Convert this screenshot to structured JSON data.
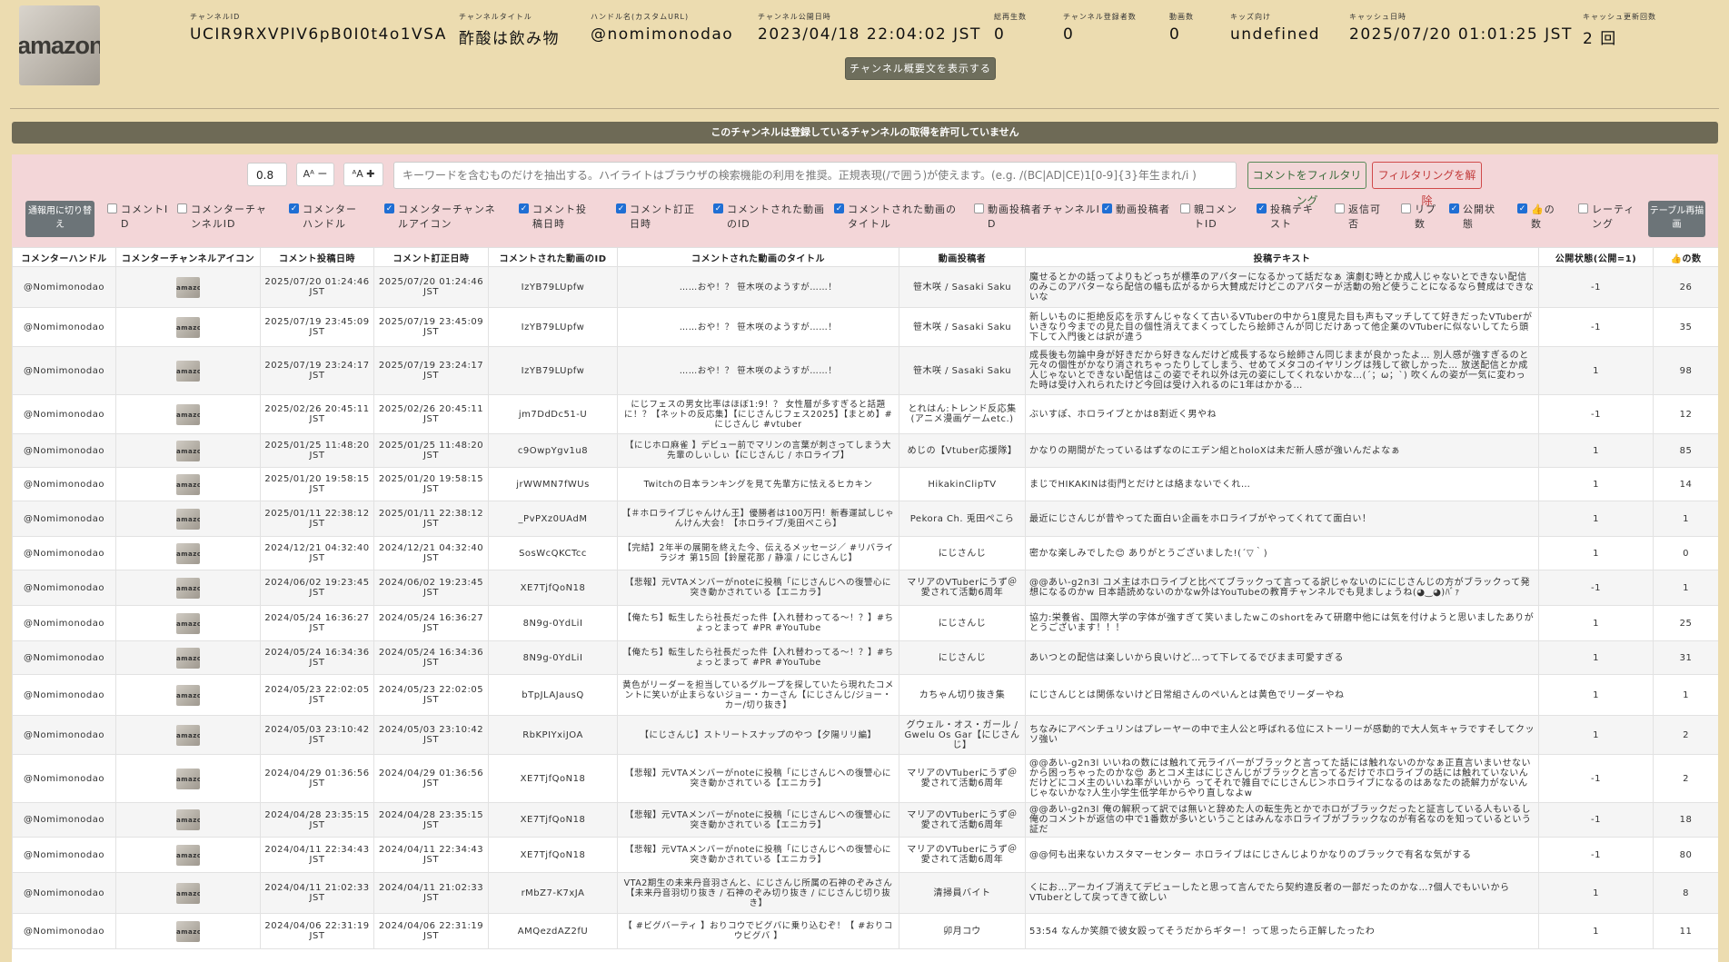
{
  "channel": {
    "stats": [
      {
        "label": "チャンネルID",
        "value": "UCIR9RXVPIV6pB0I0t4o1VSA"
      },
      {
        "label": "チャンネルタイトル",
        "value": "酢酸は飲み物"
      },
      {
        "label": "ハンドル名(カスタムURL)",
        "value": "@nomimonodao"
      },
      {
        "label": "チャンネル公開日時",
        "value": "2023/04/18 22:04:02 JST"
      },
      {
        "label": "総再生数",
        "value": "0"
      },
      {
        "label": "チャンネル登録者数",
        "value": "0"
      },
      {
        "label": "動画数",
        "value": "0"
      },
      {
        "label": "キッズ向け",
        "value": "undefined"
      },
      {
        "label": "キャッシュ日時",
        "value": "2025/07/20 01:01:25 JST"
      },
      {
        "label": "キャッシュ更新回数",
        "value": "2 回"
      }
    ],
    "avatar_text": "amazon",
    "desc_button": "チャンネル概要文を表示する",
    "notice": "このチャンネルは登録しているチャンネルの取得を許可していません"
  },
  "toolbar": {
    "zoom_value": "0.8",
    "font_minus": "Aᴬ ー",
    "font_plus": "ᴬA ✚",
    "search_placeholder": "キーワードを含むものだけを抽出する。ハイライトはブラウザの検索機能の利用を推奨。正規表現(/で囲う)が使えます。(e.g. /(BC|AD|CE)1[0-9]{3}年生まれ/i )",
    "filter_label": "コメントをフィルタリング",
    "clear_label": "フィルタリングを解除",
    "mode_label": "通報用に切り替え",
    "redraw_label": "テーブル再描画"
  },
  "column_toggles": [
    {
      "label": "コメントID",
      "checked": false
    },
    {
      "label": "コメンターチャンネルID",
      "checked": false
    },
    {
      "label": "コメンターハンドル",
      "checked": true
    },
    {
      "label": "コメンターチャンネルアイコン",
      "checked": true
    },
    {
      "label": "コメント投稿日時",
      "checked": true
    },
    {
      "label": "コメント訂正日時",
      "checked": true
    },
    {
      "label": "コメントされた動画のID",
      "checked": true
    },
    {
      "label": "コメントされた動画のタイトル",
      "checked": true
    },
    {
      "label": "動画投稿者チャンネルID",
      "checked": false
    },
    {
      "label": "動画投稿者",
      "checked": true
    },
    {
      "label": "親コメントID",
      "checked": false
    },
    {
      "label": "投稿テキスト",
      "checked": true
    },
    {
      "label": "返信可否",
      "checked": false
    },
    {
      "label": "リプ数",
      "checked": false
    },
    {
      "label": "公開状態",
      "checked": true
    },
    {
      "label": "👍の数",
      "checked": true
    },
    {
      "label": "レーティング",
      "checked": false
    }
  ],
  "table": {
    "headers": [
      "コメンターハンドル",
      "コメンターチャンネルアイコン",
      "コメント投稿日時",
      "コメント訂正日時",
      "コメントされた動画のID",
      "コメントされた動画のタイトル",
      "動画投稿者",
      "投稿テキスト",
      "公開状態(公開=1)",
      "👍の数"
    ],
    "rows": [
      {
        "handle": "@Nomimonodao",
        "posted": "2025/07/20 01:24:46 JST",
        "edited": "2025/07/20 01:24:46 JST",
        "video_id": "IzYB79LUpfw",
        "title": "……おや！？ 笹木咲のようすが……！",
        "author": "笹木咲 / Sasaki Saku",
        "text": "魔せるとかの話ってよりもどっちが標準のアバターになるかって話だなぁ 演劇む時とか成人じゃないとできない配信のみこのアバターなら配信の幅も広がるから大賛成だけどこのアバターが活動の殆ど使うことになるなら賛成はできないな",
        "status": "-1",
        "likes": "26"
      },
      {
        "handle": "@Nomimonodao",
        "posted": "2025/07/19 23:45:09 JST",
        "edited": "2025/07/19 23:45:09 JST",
        "video_id": "IzYB79LUpfw",
        "title": "……おや！？ 笹木咲のようすが……！",
        "author": "笹木咲 / Sasaki Saku",
        "text": "新しいものに拒絶反応を示すんじゃなくて古いるVTuberの中から1度見た目も声もマッチしてて好きだったVTuberがいきなり今までの見た目の個性消えてまくってしたら絵師さんが同じだけあって他企業のVTuberに似ないしてたら頭下して入門後とは訳が違う",
        "status": "-1",
        "likes": "35"
      },
      {
        "handle": "@Nomimonodao",
        "posted": "2025/07/19 23:24:17 JST",
        "edited": "2025/07/19 23:24:17 JST",
        "video_id": "IzYB79LUpfw",
        "title": "……おや！？ 笹木咲のようすが……！",
        "author": "笹木咲 / Sasaki Saku",
        "text": "成長後も勿論中身が好きだから好きなんだけど成長するなら絵師さん同じままが良かったよ… 別人感が強すぎるのと元々の個性がかなり消されちゃったりしてしまう、せめてメタコのイヤリングは残して欲しかった… 放送配信とか成人じゃないとできない配信はこの姿でそれ以外は元の姿にしてくれないかな…(´；ω；`) 吹くんの姿が一気に変わった時は受け入れられたけど今回は受け入れるのに1年はかかる…",
        "status": "1",
        "likes": "98"
      },
      {
        "handle": "@Nomimonodao",
        "posted": "2025/02/26 20:45:11 JST",
        "edited": "2025/02/26 20:45:11 JST",
        "video_id": "jm7DdDc51-U",
        "title": "にじフェスの男女比率はほぼ1:9！？ 女性層が多すぎると話題に！？【ネットの反応集】【にじさんじフェス2025】【まとめ】#にじさんじ #vtuber",
        "author": "とれはん:トレンド反応集(アニメ漫画ゲームetc.)",
        "text": "ぶいすぽ、ホロライブとかは8割近く男やね",
        "status": "-1",
        "likes": "12"
      },
      {
        "handle": "@Nomimonodao",
        "posted": "2025/01/25 11:48:20 JST",
        "edited": "2025/01/25 11:48:20 JST",
        "video_id": "c9OwpYgv1u8",
        "title": "【にじホロ麻雀 】デビュー前でマリンの言葉が刺さってしまう大先輩のしぃしぃ【にじさんじ / ホロライブ】",
        "author": "めじの【Vtuber応援隊】",
        "text": "かなりの期間がたっているはずなのにエデン組とholoXは未だ新人感が強いんだよなぁ",
        "status": "1",
        "likes": "85"
      },
      {
        "handle": "@Nomimonodao",
        "posted": "2025/01/20 19:58:15 JST",
        "edited": "2025/01/20 19:58:15 JST",
        "video_id": "jrWWMN7fWUs",
        "title": "Twitchの日本ランキングを見て先輩方に怯えるヒカキン",
        "author": "HikakinClipTV",
        "text": "まじでHIKAKINは街門とだけとは絡まないでくれ…",
        "status": "1",
        "likes": "14"
      },
      {
        "handle": "@Nomimonodao",
        "posted": "2025/01/11 22:38:12 JST",
        "edited": "2025/01/11 22:38:12 JST",
        "video_id": "_PvPXz0UAdM",
        "title": "【＃ホロライブじゃんけん王】優勝者は100万円！新春運試しじゃんけん大会！【ホロライブ/兎田ぺこら】",
        "author": "Pekora Ch. 兎田ぺこら",
        "text": "最近にじさんじが昔やってた面白い企画をホロライブがやってくれてて面白い！",
        "status": "1",
        "likes": "1"
      },
      {
        "handle": "@Nomimonodao",
        "posted": "2024/12/21 04:32:40 JST",
        "edited": "2024/12/21 04:32:40 JST",
        "video_id": "SosWcQKCTcc",
        "title": "【完結】2年半の展開を終えた今、伝えるメッセージ／ #リバライラジオ 第15回【鈴屋花那 / 静凛 / にじさんじ】",
        "author": "にじさんじ",
        "text": "密かな楽しみでした😊 ありがとうございました!(´▽｀)",
        "status": "1",
        "likes": "0"
      },
      {
        "handle": "@Nomimonodao",
        "posted": "2024/06/02 19:23:45 JST",
        "edited": "2024/06/02 19:23:45 JST",
        "video_id": "XE7TjfQoN18",
        "title": "【悲報】元VTAメンバーがnoteに投稿「にじさんじへの復讐心に突き動かされている【エニカラ】",
        "author": "マリアのVTuberにうず＠愛されて活動6周年",
        "text": "@@あい-g2n3l コメ主はホロライブと比べてブラックって言ってる訳じゃないのににじさんじの方がブラックって発想になるのかw 日本語読めないのかなw外はYouTubeの教育チャンネルでも見ましょうね(◕‿◕)ﾊﾞｧ",
        "status": "-1",
        "likes": "1"
      },
      {
        "handle": "@Nomimonodao",
        "posted": "2024/05/24 16:36:27 JST",
        "edited": "2024/05/24 16:36:27 JST",
        "video_id": "8N9g-0YdLiI",
        "title": "【俺たち】転生したら社長だった件【入れ替わってる〜！？】#ちょっとまって #PR #YouTube",
        "author": "にじさんじ",
        "text": "協力:栄養省、国際大学の字体が強すぎて笑いましたwこのshortをみて研磨中他には気を付けようと思いましたありがとうございます！！！",
        "status": "1",
        "likes": "25"
      },
      {
        "handle": "@Nomimonodao",
        "posted": "2024/05/24 16:34:36 JST",
        "edited": "2024/05/24 16:34:36 JST",
        "video_id": "8N9g-0YdLiI",
        "title": "【俺たち】転生したら社長だった件【入れ替わってる〜！？】#ちょっとまって #PR #YouTube",
        "author": "にじさんじ",
        "text": "あいつとの配信は楽しいから良いけど…って下レてるでびまま可愛すぎる",
        "status": "1",
        "likes": "31"
      },
      {
        "handle": "@Nomimonodao",
        "posted": "2024/05/23 22:02:05 JST",
        "edited": "2024/05/23 22:02:05 JST",
        "video_id": "bTpJLAJausQ",
        "title": "黄色がリーダーを担当しているグループを探していたら現れたコメントに笑いが止まらないジョー・カーさん【にじさんじ/ジョー・カー/切り抜き】",
        "author": "カちゃん切り抜き集",
        "text": "にじさんじとは関係ないけど日常組さんのぺいんとは黄色でリーダーやね",
        "status": "1",
        "likes": "1"
      },
      {
        "handle": "@Nomimonodao",
        "posted": "2024/05/03 23:10:42 JST",
        "edited": "2024/05/03 23:10:42 JST",
        "video_id": "RbKPIYxiJOA",
        "title": "【にじさんじ】ストリートスナップのやつ【夕陽リリ編】",
        "author": "グウェル・オス・ガール / Gwelu Os Gar【にじさんじ】",
        "text": "ちなみにアベンチュリンはプレーヤーの中で主人公と呼ばれる位にストーリーが感動的で大人気キャラですそしてクッソ強い",
        "status": "1",
        "likes": "2"
      },
      {
        "handle": "@Nomimonodao",
        "posted": "2024/04/29 01:36:56 JST",
        "edited": "2024/04/29 01:36:56 JST",
        "video_id": "XE7TjfQoN18",
        "title": "【悲報】元VTAメンバーがnoteに投稿「にじさんじへの復讐心に突き動かされている【エニカラ】",
        "author": "マリアのVTuberにうず＠愛されて活動6周年",
        "text": "@@あい-g2n3l いいねの数には触れて元ライバーがブラックと言ってた話には触れないのかなぁ正直言いまいせないから困っちゃったのかな😍 あとコメ主はにじさんじがブラックと言ってるだけでホロライブの話には触れていないんだけどにコメ主のいいね率がいいから ってそれで雑自でにじさんじ＞ホロライブになるのはあなたの読解力がないんじゃないかな?人生小学生低学年からやり直しなよw",
        "status": "-1",
        "likes": "2"
      },
      {
        "handle": "@Nomimonodao",
        "posted": "2024/04/28 23:35:15 JST",
        "edited": "2024/04/28 23:35:15 JST",
        "video_id": "XE7TjfQoN18",
        "title": "【悲報】元VTAメンバーがnoteに投稿「にじさんじへの復讐心に突き動かされている【エニカラ】",
        "author": "マリアのVTuberにうず＠愛されて活動6周年",
        "text": "@@あい-g2n3l 俺の解釈って訳では無いと辞めた人の転生先とかでホロがブラックだったと証言している人もいるし俺のコメントが返信の中で1番数が多いということはみんなホロライブがブラックなのが有名なのを知っているという証だ",
        "status": "-1",
        "likes": "18"
      },
      {
        "handle": "@Nomimonodao",
        "posted": "2024/04/11 22:34:43 JST",
        "edited": "2024/04/11 22:34:43 JST",
        "video_id": "XE7TjfQoN18",
        "title": "【悲報】元VTAメンバーがnoteに投稿「にじさんじへの復讐心に突き動かされている【エニカラ】",
        "author": "マリアのVTuberにうず＠愛されて活動6周年",
        "text": "@@何も出来ないカスタマーセンター ホロライブはにじさんじよりかなりのブラックで有名な気がする",
        "status": "-1",
        "likes": "80"
      },
      {
        "handle": "@Nomimonodao",
        "posted": "2024/04/11 21:02:33 JST",
        "edited": "2024/04/11 21:02:33 JST",
        "video_id": "rMbZ7-K7xJA",
        "title": "VTA2期生の未来丹音羽さんと、にじさんじ所属の石神のぞみさん【未来丹音羽切り抜き / 石神のぞみ切り抜き / にじさんじ切り抜き】",
        "author": "清掃員バイト",
        "text": "くにお…アーカイブ消えてデビューしたと思って言んでたら契約違反者の一部だったのかな…?個人でもいいからVTuberとして戻ってきて欲しい",
        "status": "1",
        "likes": "8"
      },
      {
        "handle": "@Nomimonodao",
        "posted": "2024/04/06 22:31:19 JST",
        "edited": "2024/04/06 22:31:19 JST",
        "video_id": "AMQezdAZ2fU",
        "title": "【 #ビグバーティ 】おりコウでビグバに乗り込むぞ！【 #おりコウビグバ 】",
        "author": "卯月コウ",
        "text": "53:54 なんか笑顔で彼女殴ってそうだからギター！って思ったら正解したったわ",
        "status": "1",
        "likes": "11"
      }
    ]
  }
}
